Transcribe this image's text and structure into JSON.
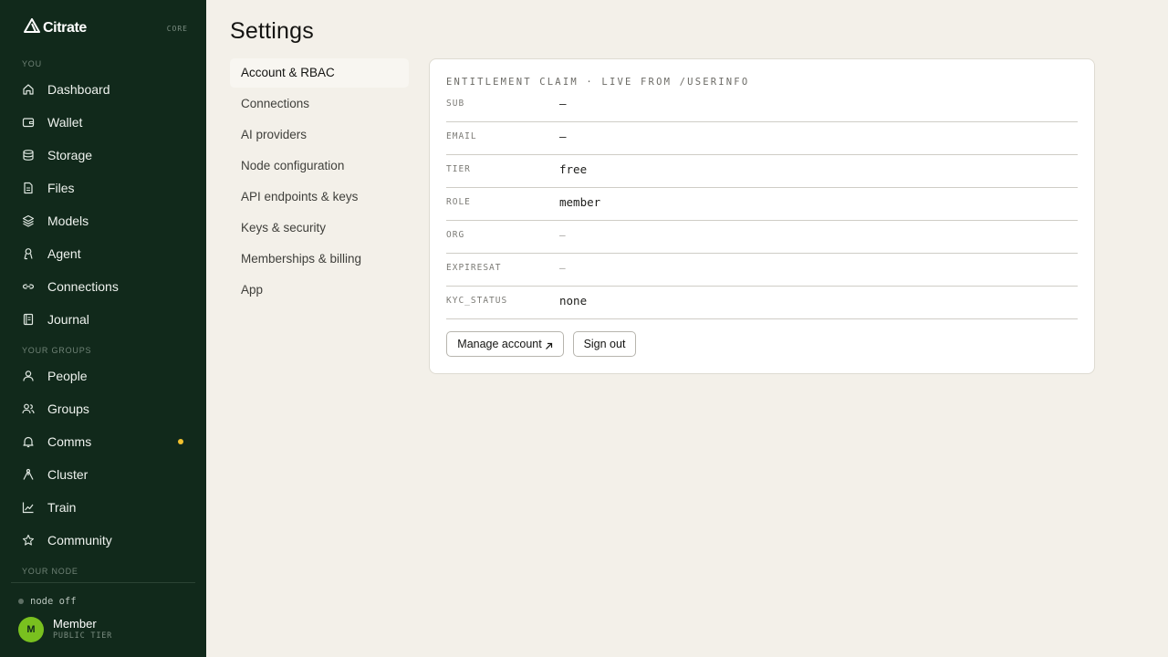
{
  "sidebar": {
    "brand": "Citrate",
    "core_tag": "CORE",
    "sections": {
      "you": "YOU",
      "your_groups": "YOUR GROUPS",
      "your_node": "YOUR NODE"
    },
    "you_items": [
      {
        "label": "Dashboard",
        "icon": "home-icon"
      },
      {
        "label": "Wallet",
        "icon": "wallet-icon"
      },
      {
        "label": "Storage",
        "icon": "database-icon"
      },
      {
        "label": "Files",
        "icon": "file-icon"
      },
      {
        "label": "Models",
        "icon": "layers-icon"
      },
      {
        "label": "Agent",
        "icon": "agent-icon"
      },
      {
        "label": "Connections",
        "icon": "link-icon"
      },
      {
        "label": "Journal",
        "icon": "journal-icon"
      }
    ],
    "group_items": [
      {
        "label": "People",
        "icon": "person-icon"
      },
      {
        "label": "Groups",
        "icon": "group-icon"
      },
      {
        "label": "Comms",
        "icon": "bell-icon",
        "notification": true
      },
      {
        "label": "Cluster",
        "icon": "cluster-icon"
      },
      {
        "label": "Train",
        "icon": "chart-icon"
      },
      {
        "label": "Community",
        "icon": "star-icon"
      }
    ],
    "node_status": "node off",
    "user": {
      "initial": "M",
      "name": "Member",
      "tier": "PUBLIC TIER"
    },
    "colors": {
      "background": "#11291b",
      "avatar": "#79c01f",
      "notification_dot": "#f2c12e"
    }
  },
  "main": {
    "title": "Settings",
    "settings_nav": [
      {
        "label": "Account & RBAC",
        "active": true
      },
      {
        "label": "Connections",
        "active": false
      },
      {
        "label": "AI providers",
        "active": false
      },
      {
        "label": "Node configuration",
        "active": false
      },
      {
        "label": "API endpoints & keys",
        "active": false
      },
      {
        "label": "Keys & security",
        "active": false
      },
      {
        "label": "Memberships & billing",
        "active": false
      },
      {
        "label": "App",
        "active": false
      }
    ],
    "card": {
      "header": "ENTITLEMENT CLAIM · LIVE FROM /USERINFO",
      "rows": [
        {
          "key": "SUB",
          "value": "–"
        },
        {
          "key": "EMAIL",
          "value": "–"
        },
        {
          "key": "TIER",
          "value": "free"
        },
        {
          "key": "ROLE",
          "value": "member"
        },
        {
          "key": "ORG",
          "value": "—"
        },
        {
          "key": "EXPIRESAT",
          "value": "—"
        },
        {
          "key": "KYC_STATUS",
          "value": "none"
        }
      ],
      "buttons": {
        "manage_account": "Manage account",
        "sign_out": "Sign out"
      }
    }
  }
}
